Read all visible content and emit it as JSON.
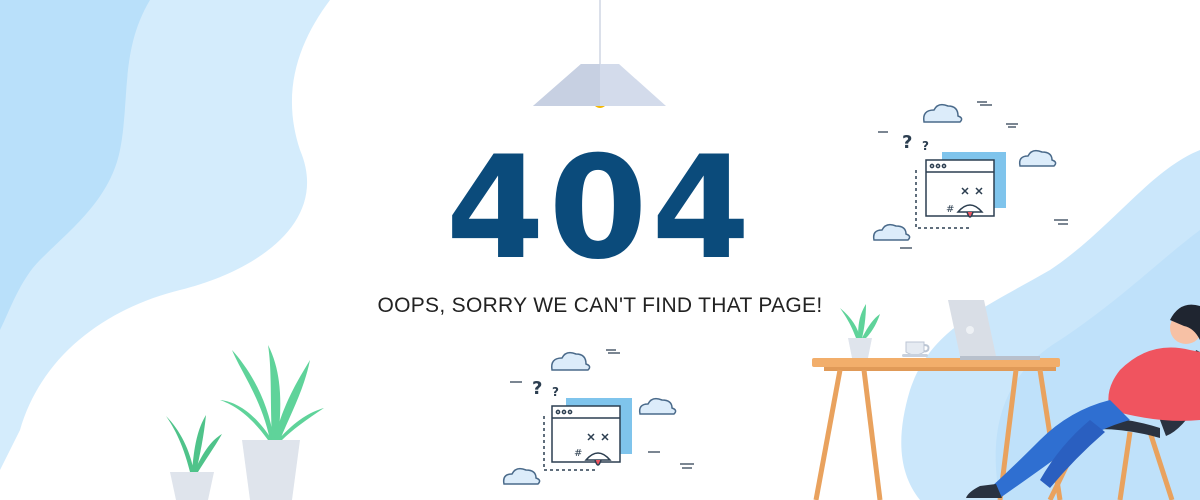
{
  "page": {
    "error_code": "404",
    "message": "OOPS, SORRY WE CAN'T FIND THAT PAGE!"
  },
  "colors": {
    "heading": "#0b4b7b",
    "text": "#222222",
    "blob_light": "#cfe9fb",
    "blob_mid": "#aedbf8",
    "plant_leaf": "#5fd39a",
    "plant_pot": "#dfe4ec",
    "desk": "#f2ae6b",
    "shirt": "#f0545f",
    "pants": "#2f6fd1",
    "lamp_shade": "#d3dbeb",
    "lamp_bulb": "#f5b800",
    "window_accent": "#7fc4ec"
  },
  "icons": [
    "ceiling-lamp-icon",
    "broken-page-icon",
    "cloud-icon",
    "question-mark-icon",
    "plant-icon",
    "laptop-icon",
    "coffee-cup-icon",
    "desk-icon",
    "chair-icon"
  ]
}
